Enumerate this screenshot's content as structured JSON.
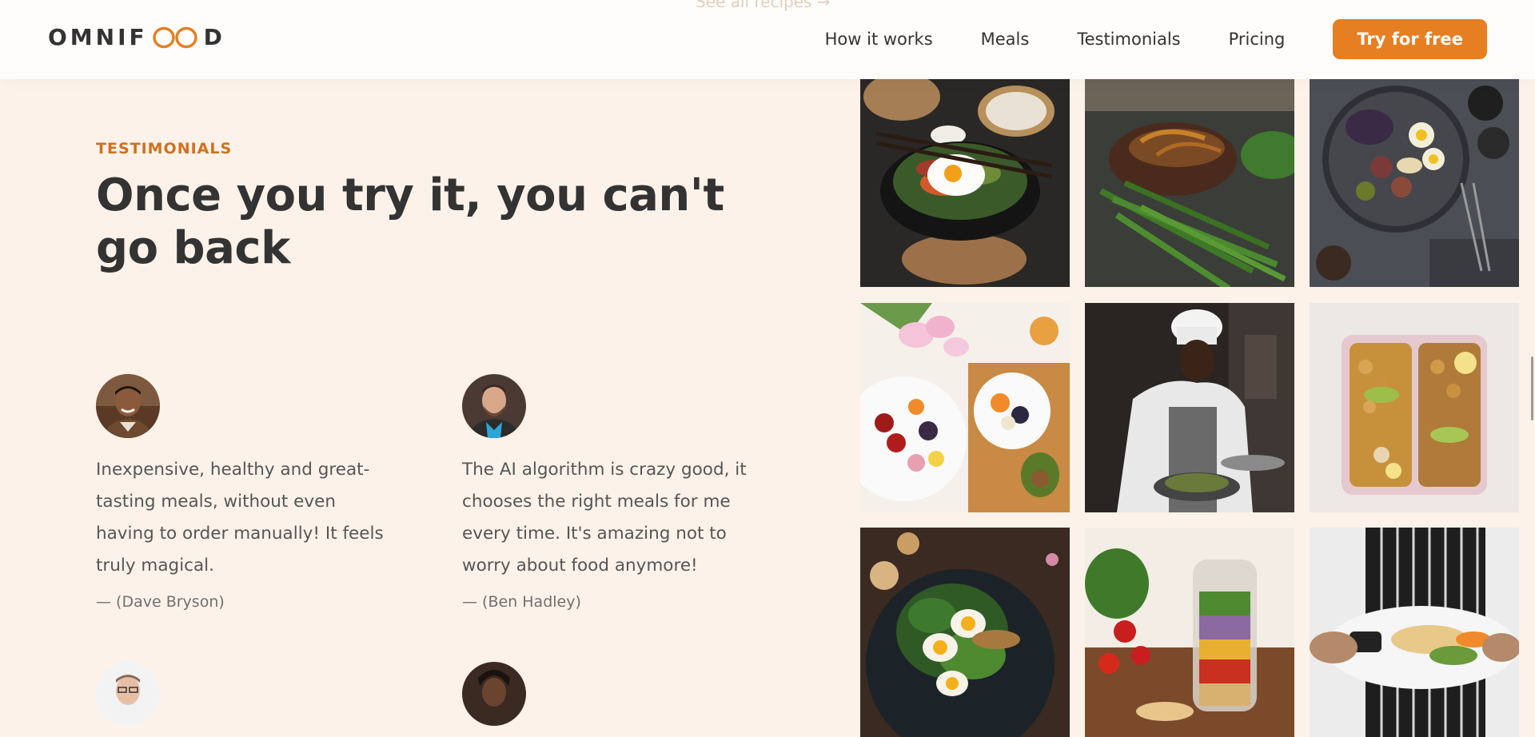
{
  "header": {
    "logo_left": "OMNIF",
    "logo_right": "D",
    "peek_text": "See all recipes →",
    "nav": [
      "How it works",
      "Meals",
      "Testimonials",
      "Pricing"
    ],
    "cta": "Try for free"
  },
  "testimonials": {
    "subheading": "TESTIMONIALS",
    "heading": "Once you try it, you can't go back",
    "items": [
      {
        "text": "Inexpensive, healthy and great-tasting meals, without even having to order manually! It feels truly magical.",
        "author": "— (Dave Bryson)"
      },
      {
        "text": "The AI algorithm is crazy good, it chooses the right meals for me every time. It's amazing not to worry about food anymore!",
        "author": "— (Ben Hadley)"
      }
    ]
  },
  "gallery": [
    "bibimbap-bowl-image",
    "steak-green-beans-image",
    "fig-platter-image",
    "fruit-breakfast-image",
    "chef-cooking-image",
    "meal-prep-boxes-image",
    "egg-salad-image",
    "jar-salad-image",
    "plated-fish-image"
  ],
  "colors": {
    "background": "#fdf2e9",
    "accent": "#e67e22",
    "accent_dark": "#cf711f",
    "text": "#333333"
  }
}
